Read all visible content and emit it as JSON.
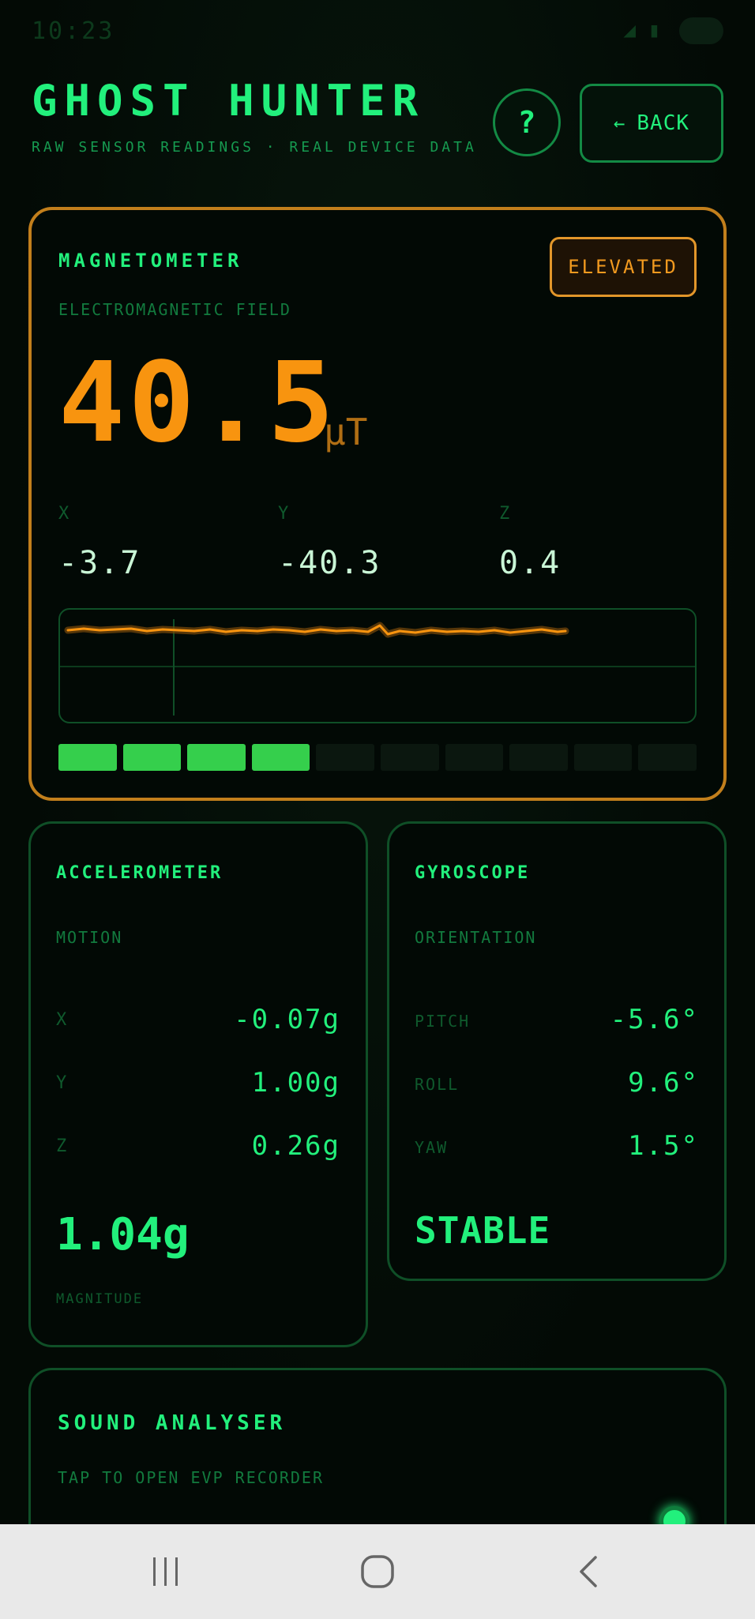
{
  "status_bar": {
    "time": "10:23",
    "icons": "◢ ▮"
  },
  "header": {
    "title": "GHOST HUNTER",
    "subtitle": "RAW SENSOR READINGS · REAL DEVICE DATA",
    "help_label": "?",
    "back_arrow": "←",
    "back_label": "BACK"
  },
  "magnetometer": {
    "title": "MAGNETOMETER",
    "subtitle": "ELECTROMAGNETIC FIELD",
    "badge": "ELEVATED",
    "value": "40.5",
    "unit": "μT",
    "axes": [
      {
        "label": "X",
        "value": "-3.7"
      },
      {
        "label": "Y",
        "value": "-40.3"
      },
      {
        "label": "Z",
        "value": "0.4"
      }
    ],
    "level_segments_on": 4,
    "level_segments_total": 10,
    "accent_color": "#f8940f"
  },
  "accelerometer": {
    "title": "ACCELEROMETER",
    "subtitle": "MOTION",
    "rows": [
      {
        "label": "X",
        "value": "-0.07g"
      },
      {
        "label": "Y",
        "value": "1.00g"
      },
      {
        "label": "Z",
        "value": "0.26g"
      }
    ],
    "magnitude": "1.04g",
    "magnitude_label": "MAGNITUDE"
  },
  "gyroscope": {
    "title": "GYROSCOPE",
    "subtitle": "ORIENTATION",
    "rows": [
      {
        "label": "PITCH",
        "value": "-5.6°"
      },
      {
        "label": "ROLL",
        "value": "9.6°"
      },
      {
        "label": "YAW",
        "value": "1.5°"
      }
    ],
    "status": "STABLE"
  },
  "sound": {
    "title": "SOUND ANALYSER",
    "subtitle": "TAP TO OPEN EVP RECORDER"
  },
  "colors": {
    "primary": "#22f07c",
    "warning": "#f8940f",
    "background": "#030a05"
  }
}
